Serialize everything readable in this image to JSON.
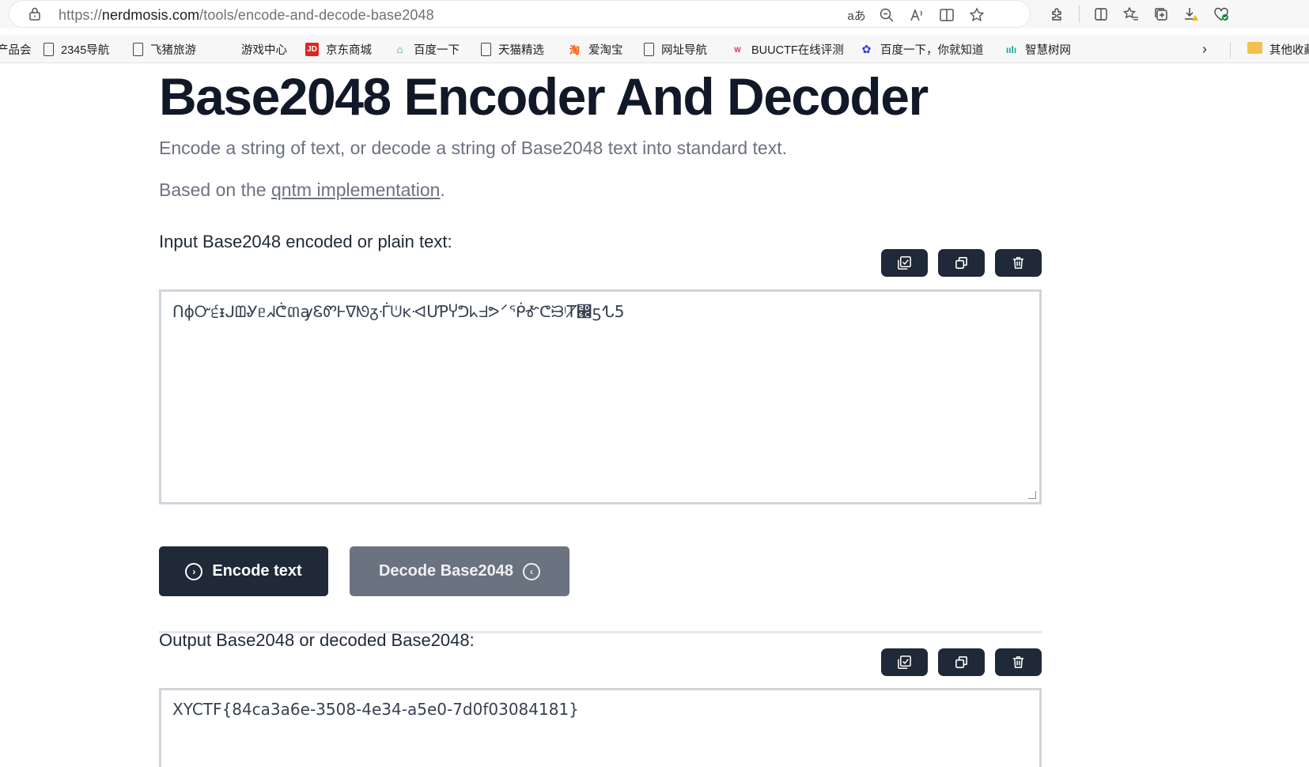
{
  "browser": {
    "url_prefix": "https://",
    "url_host": "nerdmosis.com",
    "url_path": "/tools/encode-and-decode-base2048",
    "translate_glyph": "aあ",
    "bookmarks": [
      {
        "label": "产品会",
        "icon": "none"
      },
      {
        "label": "2345导航",
        "icon": "doc"
      },
      {
        "label": "飞猪旅游",
        "icon": "doc"
      },
      {
        "label": "游戏中心",
        "icon": "none"
      },
      {
        "label": "京东商城",
        "icon": "jd",
        "glyph": "JD"
      },
      {
        "label": "百度一下",
        "icon": "eco",
        "glyph": "⌂"
      },
      {
        "label": "天猫精选",
        "icon": "doc"
      },
      {
        "label": "爱淘宝",
        "icon": "tao",
        "glyph": "淘"
      },
      {
        "label": "网址导航",
        "icon": "doc"
      },
      {
        "label": "BUUCTF在线评测",
        "icon": "buu",
        "glyph": "W"
      },
      {
        "label": "百度一下，你就知道",
        "icon": "bai",
        "glyph": "✿"
      },
      {
        "label": "智慧树网",
        "icon": "bars",
        "glyph": "ıılı"
      }
    ],
    "other_bookmarks": "其他收藏"
  },
  "page": {
    "title": "Base2048 Encoder And Decoder",
    "subtitle": "Encode a string of text, or decode a string of Base2048 text into standard text.",
    "based_prefix": "Based on the ",
    "based_link": "qntm implementation",
    "based_suffix": "."
  },
  "input": {
    "label": "Input Base2048 encoded or plain text:",
    "value": "ՈϕᏅ੬ᵻᒍᗶᎽᥱᖽᕧ៣ꜽᏋᏛᎰᐁᘚᵹᒰᕫᴋᐗՍƤჄᕤᖾᖵᕗ⸍ᖀᎹᕦᙣᵎȾ⵬ƽᖍ5"
  },
  "actions": {
    "encode": "Encode text",
    "decode": "Decode Base2048"
  },
  "output": {
    "label": "Output Base2048 or decoded Base2048:",
    "value": "XYCTF{84ca3a6e-3508-4e34-a5e0-7d0f03084181}"
  },
  "colors": {
    "dark": "#1f2937",
    "gray_button": "#6b7280",
    "heading": "#111827",
    "muted": "#6b7280",
    "border": "#d1d5db"
  }
}
